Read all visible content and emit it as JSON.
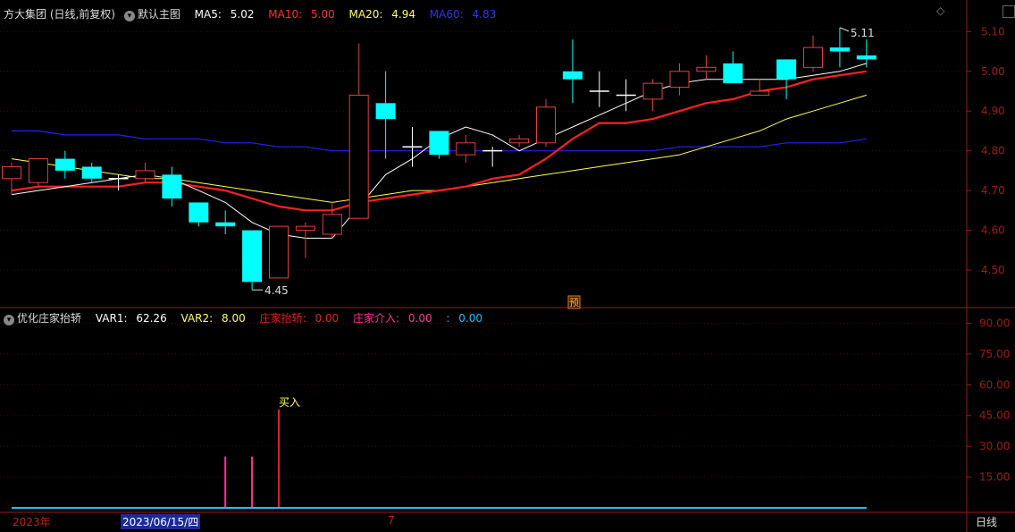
{
  "main_header": {
    "title": "方大集团 (日线,前复权)",
    "template": "默认主图",
    "ma5_label": "MA5:",
    "ma5_value": "5.02",
    "ma10_label": "MA10:",
    "ma10_value": "5.00",
    "ma20_label": "MA20:",
    "ma20_value": "4.94",
    "ma60_label": "MA60:",
    "ma60_value": "4.83"
  },
  "sub_header": {
    "title": "优化庄家抬轿",
    "var1_label": "VAR1:",
    "var1_value": "62.26",
    "var2_label": "VAR2:",
    "var2_value": "8.00",
    "lift_label": "庄家抬轿:",
    "lift_value": "0.00",
    "entry_label": "庄家介入:",
    "entry_value": "0.00",
    "blank_label": ":",
    "blank_value": "0.00"
  },
  "bottom_bar": {
    "year": "2023年",
    "cursor_date": "2023/06/15/四",
    "month": "7",
    "period": "日线"
  },
  "colors": {
    "up": "#e04040",
    "down": "#00ffff",
    "ma5": "#ffffff",
    "ma10": "#ff2020",
    "ma20": "#ffff60",
    "ma60": "#2020ff",
    "axis": "#a01818",
    "pink": "#ff3399"
  },
  "chart_data": [
    {
      "type": "candlestick",
      "y_ticks": [
        "5.10",
        "5.00",
        "4.90",
        "4.80",
        "4.70",
        "4.60",
        "4.50"
      ],
      "ylim": [
        4.41,
        5.13
      ],
      "annotations": {
        "low_label": "4.45",
        "high_label": "5.11",
        "marker": "预"
      },
      "candles": [
        {
          "o": 4.73,
          "h": 4.77,
          "l": 4.69,
          "c": 4.76
        },
        {
          "o": 4.72,
          "h": 4.78,
          "l": 4.71,
          "c": 4.78
        },
        {
          "o": 4.78,
          "h": 4.8,
          "l": 4.73,
          "c": 4.75
        },
        {
          "o": 4.76,
          "h": 4.77,
          "l": 4.72,
          "c": 4.73
        },
        {
          "o": 4.73,
          "h": 4.74,
          "l": 4.7,
          "c": 4.73
        },
        {
          "o": 4.73,
          "h": 4.77,
          "l": 4.72,
          "c": 4.75
        },
        {
          "o": 4.74,
          "h": 4.76,
          "l": 4.66,
          "c": 4.68
        },
        {
          "o": 4.67,
          "h": 4.67,
          "l": 4.61,
          "c": 4.62
        },
        {
          "o": 4.62,
          "h": 4.65,
          "l": 4.59,
          "c": 4.61
        },
        {
          "o": 4.6,
          "h": 4.6,
          "l": 4.45,
          "c": 4.47
        },
        {
          "o": 4.48,
          "h": 4.61,
          "l": 4.48,
          "c": 4.61
        },
        {
          "o": 4.6,
          "h": 4.62,
          "l": 4.53,
          "c": 4.61
        },
        {
          "o": 4.59,
          "h": 4.67,
          "l": 4.58,
          "c": 4.64
        },
        {
          "o": 4.63,
          "h": 5.07,
          "l": 4.63,
          "c": 4.94
        },
        {
          "o": 4.92,
          "h": 5.0,
          "l": 4.78,
          "c": 4.88
        },
        {
          "o": 4.81,
          "h": 4.86,
          "l": 4.76,
          "c": 4.81
        },
        {
          "o": 4.85,
          "h": 4.85,
          "l": 4.78,
          "c": 4.79
        },
        {
          "o": 4.79,
          "h": 4.84,
          "l": 4.77,
          "c": 4.82
        },
        {
          "o": 4.8,
          "h": 4.81,
          "l": 4.76,
          "c": 4.8
        },
        {
          "o": 4.82,
          "h": 4.84,
          "l": 4.81,
          "c": 4.83
        },
        {
          "o": 4.82,
          "h": 4.93,
          "l": 4.81,
          "c": 4.91
        },
        {
          "o": 5.0,
          "h": 5.08,
          "l": 4.92,
          "c": 4.98
        },
        {
          "o": 4.95,
          "h": 5.0,
          "l": 4.91,
          "c": 4.95
        },
        {
          "o": 4.94,
          "h": 4.98,
          "l": 4.9,
          "c": 4.94
        },
        {
          "o": 4.93,
          "h": 4.98,
          "l": 4.9,
          "c": 4.97
        },
        {
          "o": 4.96,
          "h": 5.02,
          "l": 4.94,
          "c": 5.0
        },
        {
          "o": 5.0,
          "h": 5.04,
          "l": 4.98,
          "c": 5.01
        },
        {
          "o": 5.02,
          "h": 5.05,
          "l": 4.98,
          "c": 4.97
        },
        {
          "o": 4.94,
          "h": 4.98,
          "l": 4.94,
          "c": 4.95
        },
        {
          "o": 5.03,
          "h": 5.03,
          "l": 4.93,
          "c": 4.98
        },
        {
          "o": 5.01,
          "h": 5.09,
          "l": 5.0,
          "c": 5.06
        },
        {
          "o": 5.06,
          "h": 5.11,
          "l": 5.01,
          "c": 5.05
        },
        {
          "o": 5.04,
          "h": 5.08,
          "l": 5.01,
          "c": 5.03
        }
      ],
      "ma5": [
        4.69,
        4.7,
        4.71,
        4.72,
        4.73,
        4.74,
        4.73,
        4.7,
        4.67,
        4.62,
        4.59,
        4.58,
        4.58,
        4.66,
        4.74,
        4.78,
        4.83,
        4.86,
        4.84,
        4.8,
        4.83,
        4.86,
        4.89,
        4.92,
        4.95,
        4.97,
        4.98,
        4.98,
        4.98,
        4.98,
        4.99,
        5.0,
        5.02
      ],
      "ma10": [
        4.7,
        4.71,
        4.71,
        4.71,
        4.71,
        4.72,
        4.72,
        4.71,
        4.7,
        4.68,
        4.66,
        4.65,
        4.65,
        4.67,
        4.68,
        4.69,
        4.7,
        4.71,
        4.73,
        4.74,
        4.78,
        4.83,
        4.87,
        4.87,
        4.88,
        4.9,
        4.92,
        4.93,
        4.95,
        4.96,
        4.98,
        4.99,
        5.0
      ],
      "ma20": [
        4.78,
        4.77,
        4.76,
        4.75,
        4.74,
        4.73,
        4.73,
        4.72,
        4.71,
        4.7,
        4.69,
        4.68,
        4.67,
        4.68,
        4.69,
        4.7,
        4.7,
        4.71,
        4.72,
        4.73,
        4.74,
        4.75,
        4.76,
        4.77,
        4.78,
        4.79,
        4.81,
        4.83,
        4.85,
        4.88,
        4.9,
        4.92,
        4.94
      ],
      "ma60": [
        4.85,
        4.85,
        4.84,
        4.84,
        4.84,
        4.83,
        4.83,
        4.83,
        4.82,
        4.82,
        4.81,
        4.81,
        4.8,
        4.8,
        4.8,
        4.8,
        4.8,
        4.8,
        4.8,
        4.8,
        4.8,
        4.8,
        4.8,
        4.8,
        4.8,
        4.81,
        4.81,
        4.81,
        4.81,
        4.82,
        4.82,
        4.82,
        4.83
      ]
    },
    {
      "type": "bar",
      "y_ticks": [
        "90.00",
        "75.00",
        "60.00",
        "45.00",
        "30.00",
        "15.00"
      ],
      "ylim": [
        0,
        95
      ],
      "signal_label": "买入",
      "bars": [
        {
          "index": 8,
          "value": 25,
          "color": "#ff3399"
        },
        {
          "index": 9,
          "value": 25,
          "color": "#ff3399"
        },
        {
          "index": 10,
          "value": 48,
          "color": "#e02020"
        }
      ]
    }
  ]
}
